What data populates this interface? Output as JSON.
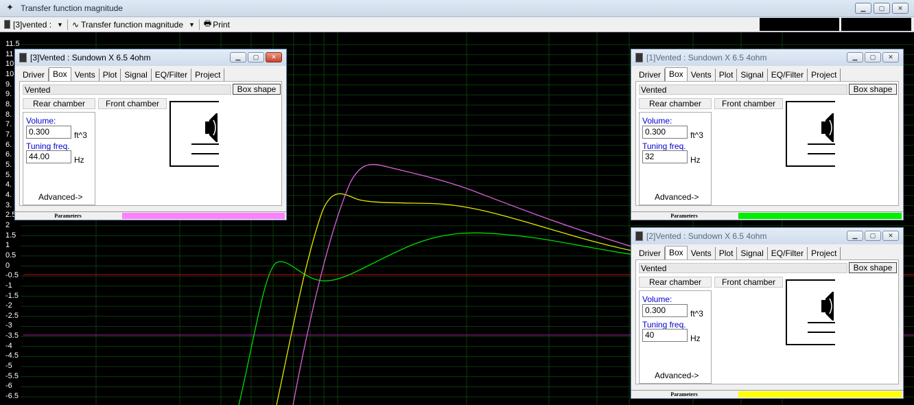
{
  "window": {
    "title": "Transfer function magnitude",
    "buttons": [
      "minimize",
      "maximize",
      "close"
    ]
  },
  "toolbar": {
    "project_select": "[3]vented :",
    "graph_select": "Transfer function magnitude",
    "print_label": "Print"
  },
  "plot": {
    "background": "#000000",
    "grid_color": "#0b3a0b",
    "y_ticks": [
      "11.5",
      "11",
      "10",
      "10",
      "9.",
      "9.",
      "8.",
      "8.",
      "7.",
      "7.",
      "6.",
      "6.",
      "5.",
      "5.",
      "4.",
      "4.",
      "3.",
      "2.5",
      "2",
      "1.5",
      "1",
      "0.5",
      "0",
      "-0.5",
      "-1",
      "-1.5",
      "-2",
      "-2.5",
      "-3",
      "-3.5",
      "-4",
      "-4.5",
      "-5",
      "-5.5",
      "-6",
      "-6.5"
    ],
    "reference_lines": [
      {
        "value": 0,
        "color": "#cc0000"
      },
      {
        "value": -3,
        "color": "#a020a0"
      }
    ],
    "curves": [
      {
        "name": "[1]",
        "color": "#00dd00"
      },
      {
        "name": "[2]",
        "color": "#e8e800"
      },
      {
        "name": "[3]",
        "color": "#e060e0"
      }
    ]
  },
  "dialogs": [
    {
      "id": "d3",
      "title": "[3]Vented : Sundown X 6.5 4ohm",
      "active": true,
      "tabs": [
        "Driver",
        "Box",
        "Vents",
        "Plot",
        "Signal",
        "EQ/Filter",
        "Project"
      ],
      "selected_tab": "Box",
      "type": "Vented",
      "box_shape_label": "Box shape",
      "rear_label": "Rear chamber",
      "front_label": "Front chamber",
      "volume_label": "Volume:",
      "volume": "0.300",
      "volume_unit": "ft^3",
      "tuning_label": "Tuning freq.",
      "tuning": "44.00",
      "tuning_unit": "Hz",
      "advanced_label": "Advanced->",
      "status_label": "Parameters",
      "swatch": "#ff80ff"
    },
    {
      "id": "d1",
      "title": "[1]Vented : Sundown X 6.5 4ohm",
      "active": false,
      "tabs": [
        "Driver",
        "Box",
        "Vents",
        "Plot",
        "Signal",
        "EQ/Filter",
        "Project"
      ],
      "selected_tab": "Box",
      "type": "Vented",
      "box_shape_label": "Box shape",
      "rear_label": "Rear chamber",
      "front_label": "Front chamber",
      "volume_label": "Volume:",
      "volume": "0.300",
      "volume_unit": "ft^3",
      "tuning_label": "Tuning freq.",
      "tuning": "32",
      "tuning_unit": "Hz",
      "advanced_label": "Advanced->",
      "status_label": "Parameters",
      "swatch": "#00ee00"
    },
    {
      "id": "d2",
      "title": "[2]Vented : Sundown X 6.5 4ohm",
      "active": false,
      "tabs": [
        "Driver",
        "Box",
        "Vents",
        "Plot",
        "Signal",
        "EQ/Filter",
        "Project"
      ],
      "selected_tab": "Box",
      "type": "Vented",
      "box_shape_label": "Box shape",
      "rear_label": "Rear chamber",
      "front_label": "Front chamber",
      "volume_label": "Volume:",
      "volume": "0.300",
      "volume_unit": "ft^3",
      "tuning_label": "Tuning freq.",
      "tuning": "40",
      "tuning_unit": "Hz",
      "advanced_label": "Advanced->",
      "status_label": "Parameters",
      "swatch": "#ffff00"
    }
  ]
}
